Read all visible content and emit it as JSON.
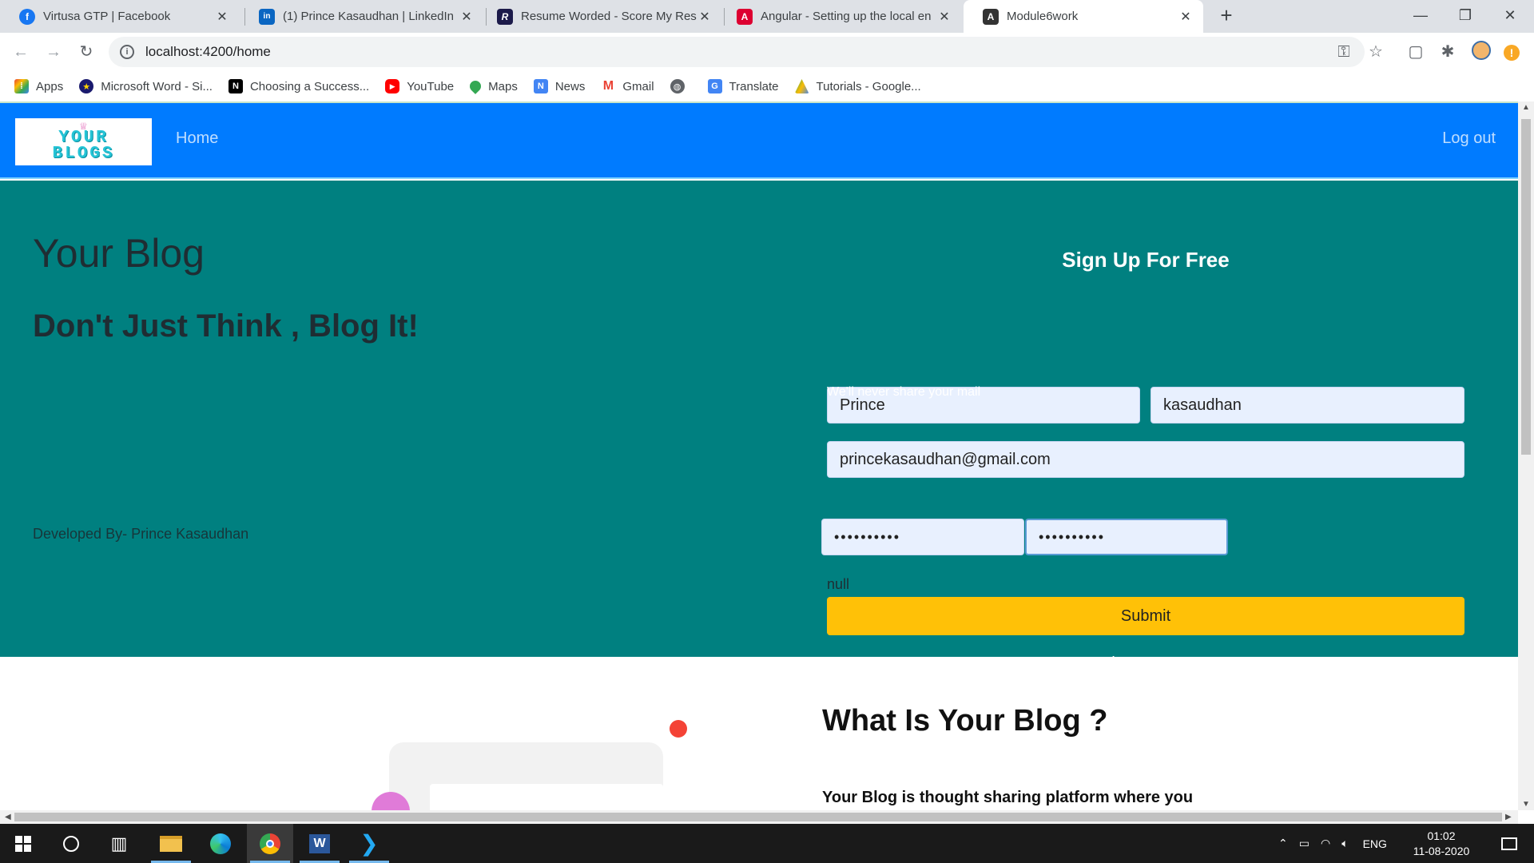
{
  "browser": {
    "tabs": [
      {
        "title": "Virtusa GTP | Facebook",
        "icon": "facebook-icon",
        "color": "#1877f2",
        "glyph": "f"
      },
      {
        "title": "(1) Prince Kasaudhan | LinkedIn",
        "icon": "linkedin-icon",
        "color": "#0a66c2",
        "glyph": "in"
      },
      {
        "title": "Resume Worded - Score My Resu",
        "icon": "resume-worded-icon",
        "color": "#1c1a4a",
        "glyph": "R"
      },
      {
        "title": "Angular - Setting up the local en",
        "icon": "angular-icon",
        "color": "#dd0031",
        "glyph": "A"
      },
      {
        "title": "Module6work",
        "icon": "angular-icon",
        "color": "#333333",
        "glyph": "A"
      }
    ],
    "url": "localhost:4200/home",
    "bookmarks": [
      {
        "label": "Apps",
        "icon": "apps-grid-icon",
        "color": "#ea4335",
        "glyph": "⋮"
      },
      {
        "label": "Microsoft Word - Si...",
        "icon": "star-badge-icon",
        "color": "#1a1a6e",
        "glyph": "★"
      },
      {
        "label": "Choosing a Success...",
        "icon": "notion-icon",
        "color": "#000000",
        "glyph": "N"
      },
      {
        "label": "YouTube",
        "icon": "youtube-icon",
        "color": "#ff0000",
        "glyph": "▶"
      },
      {
        "label": "Maps",
        "icon": "maps-pin-icon",
        "color": "#34a853",
        "glyph": "●"
      },
      {
        "label": "News",
        "icon": "news-icon",
        "color": "#4285f4",
        "glyph": "N"
      },
      {
        "label": "Gmail",
        "icon": "gmail-icon",
        "color": "#ea4335",
        "glyph": "M"
      },
      {
        "label": "",
        "icon": "globe-icon",
        "color": "#5f6368",
        "glyph": "◍"
      },
      {
        "label": "Translate",
        "icon": "translate-icon",
        "color": "#4285f4",
        "glyph": "G"
      },
      {
        "label": "Tutorials - Google...",
        "icon": "google-drive-icon",
        "color": "#fbbc04",
        "glyph": "▲"
      }
    ]
  },
  "site": {
    "logo": {
      "line1": "YOUR",
      "line2": "BLOGS"
    },
    "nav": {
      "home": "Home",
      "logout": "Log out"
    },
    "hero": {
      "title": "Your Blog",
      "tagline": "Don't Just Think , Blog It!",
      "developer": "Developed By- Prince Kasaudhan"
    },
    "signup": {
      "title": "Sign Up For Free",
      "first_name": "Prince",
      "last_name": "kasaudhan",
      "email": "princekasaudhan@gmail.com",
      "email_hint": "We'll never share your mail",
      "password": "••••••••••",
      "confirm_password": "••••••••••",
      "status": "null",
      "submit": "Submit",
      "login_link": "Login To Account"
    },
    "about": {
      "title": "What Is Your Blog ?",
      "text": "Your Blog is thought sharing platform where you"
    }
  },
  "taskbar": {
    "language": "ENG",
    "time": "01:02",
    "date": "11-08-2020"
  },
  "colors": {
    "navbar": "#007bff",
    "hero": "#008080",
    "submit": "#ffc107"
  }
}
